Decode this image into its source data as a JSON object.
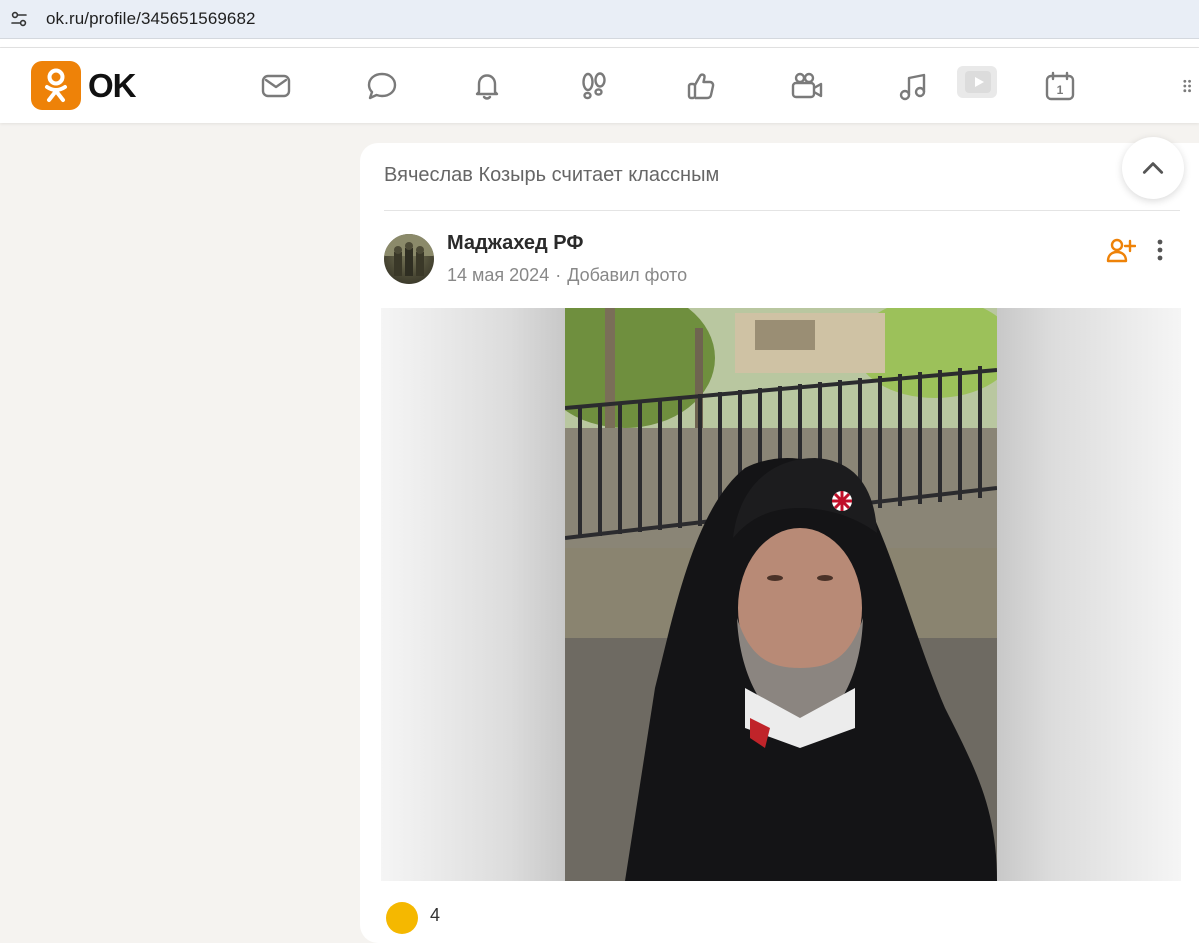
{
  "browser": {
    "url": "ok.ru/profile/345651569682"
  },
  "header": {
    "logo_text": "OK",
    "brand_color": "#ee8208",
    "nav": [
      {
        "name": "messages-icon"
      },
      {
        "name": "discussions-icon"
      },
      {
        "name": "notifications-icon"
      },
      {
        "name": "guests-icon"
      },
      {
        "name": "likes-icon"
      },
      {
        "name": "video-icon"
      },
      {
        "name": "music-icon"
      },
      {
        "name": "video-play-icon"
      },
      {
        "name": "calendar-icon"
      },
      {
        "name": "more-grid-icon"
      }
    ],
    "calendar_day": "1"
  },
  "feed": {
    "activity_text": "Вячеслав Козырь считает классным",
    "post": {
      "author": "Маджахед РФ",
      "date": "14 мая 2024",
      "separator": "·",
      "action": "Добавил фото"
    }
  },
  "reactions": {
    "count": "4"
  }
}
